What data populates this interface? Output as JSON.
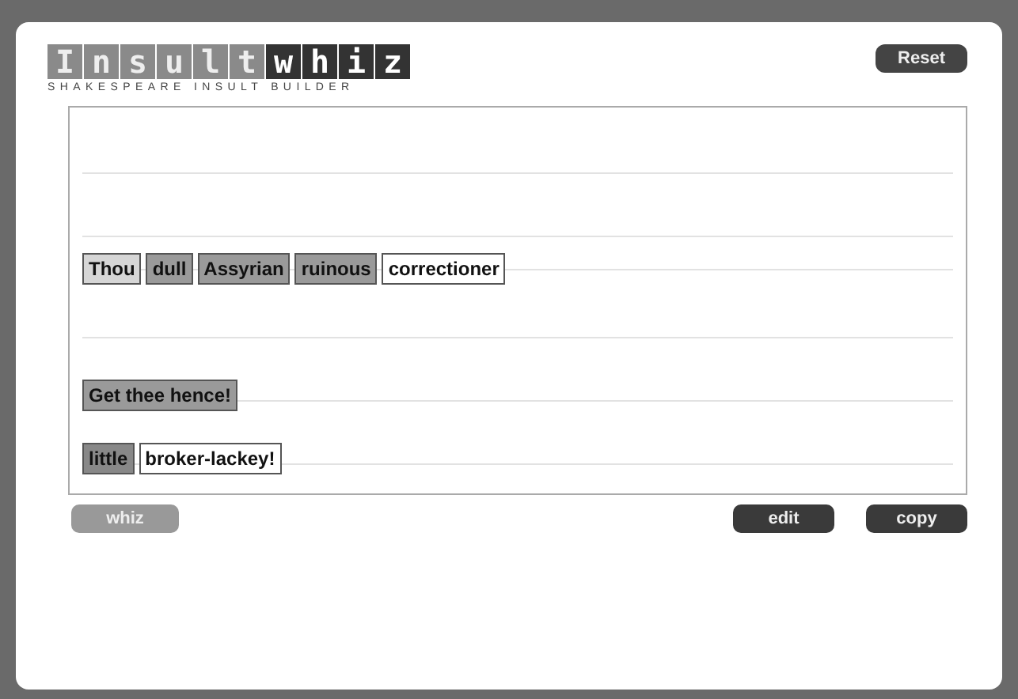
{
  "logo": {
    "letters": [
      {
        "char": "I",
        "kind": "light"
      },
      {
        "char": "n",
        "kind": "light"
      },
      {
        "char": "s",
        "kind": "light"
      },
      {
        "char": "u",
        "kind": "light"
      },
      {
        "char": "l",
        "kind": "light"
      },
      {
        "char": "t",
        "kind": "light"
      },
      {
        "char": "w",
        "kind": "dark"
      },
      {
        "char": "h",
        "kind": "dark"
      },
      {
        "char": "i",
        "kind": "dark"
      },
      {
        "char": "z",
        "kind": "dark"
      }
    ],
    "subtitle": "SHAKESPEARE INSULT BUILDER"
  },
  "reset_button": "Reset",
  "lines": [
    {
      "kind": "empty"
    },
    {
      "kind": "empty"
    },
    {
      "kind": "words",
      "words": [
        {
          "text": "Thou",
          "kind": "pronoun"
        },
        {
          "text": "dull",
          "kind": "adjective"
        },
        {
          "text": "Assyrian",
          "kind": "adjective"
        },
        {
          "text": "ruinous",
          "kind": "adjective"
        },
        {
          "text": "correctioner",
          "kind": "noun"
        }
      ]
    },
    {
      "kind": "empty"
    },
    {
      "kind": "words",
      "words": [
        {
          "text": "Get thee hence!",
          "kind": "phrase"
        }
      ]
    },
    {
      "kind": "words",
      "words": [
        {
          "text": "little",
          "kind": "modifier"
        },
        {
          "text": "broker-lackey!",
          "kind": "noun"
        }
      ]
    }
  ],
  "buttons": [
    {
      "label": "whiz",
      "kind": "light"
    },
    {
      "label": "edit",
      "kind": "dark"
    },
    {
      "label": "copy",
      "kind": "dark"
    }
  ]
}
